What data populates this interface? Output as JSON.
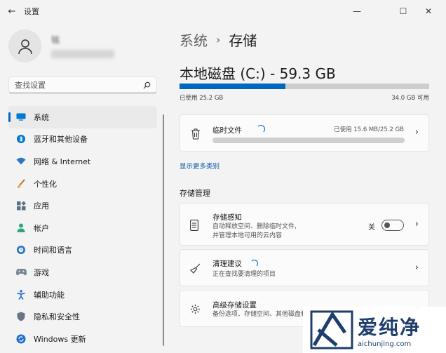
{
  "window": {
    "title": "设置",
    "back_glyph": "←",
    "min_glyph": "—",
    "max_glyph": "☐",
    "close_glyph": "✕"
  },
  "user": {
    "name": "铭"
  },
  "search": {
    "placeholder": "查找设置"
  },
  "nav": [
    {
      "label": "系统",
      "icon": "monitor-icon",
      "selected": true
    },
    {
      "label": "蓝牙和其他设备",
      "icon": "bluetooth-icon"
    },
    {
      "label": "网络 & Internet",
      "icon": "wifi-icon"
    },
    {
      "label": "个性化",
      "icon": "brush-icon"
    },
    {
      "label": "应用",
      "icon": "apps-icon"
    },
    {
      "label": "帐户",
      "icon": "person-icon"
    },
    {
      "label": "时间和语言",
      "icon": "globe-clock-icon"
    },
    {
      "label": "游戏",
      "icon": "gamepad-icon"
    },
    {
      "label": "辅助功能",
      "icon": "accessibility-icon"
    },
    {
      "label": "隐私和安全性",
      "icon": "shield-icon"
    },
    {
      "label": "Windows 更新",
      "icon": "update-icon"
    }
  ],
  "breadcrumb": {
    "parent": "系统",
    "separator": "›",
    "current": "存储"
  },
  "disk": {
    "title": "本地磁盘 (C:) - 59.3 GB",
    "used_label": "已使用 25.2 GB",
    "available_label": "34.0 GB 可用",
    "used_fraction": 0.425
  },
  "temp_files": {
    "title": "临时文件",
    "usage": "已使用 15.6 MB/25.2 GB"
  },
  "show_more": "显示更多类别",
  "storage_mgmt": {
    "heading": "存储管理",
    "sense": {
      "title": "存储感知",
      "desc1": "自动释放空间、删除临时文件,",
      "desc2": "并管理本地可用的云内容",
      "toggle_label": "关",
      "toggle_on": false
    },
    "cleanup": {
      "title": "清理建议",
      "desc": "正在查找要清理的项目"
    },
    "advanced": {
      "title": "高级存储设置",
      "desc": "备份选项、存储空间、其他磁盘和..."
    }
  },
  "watermark": {
    "cn": "爱纯净",
    "en": "aichunjing.com"
  },
  "colors": {
    "accent": "#0067c0",
    "logo": "#1f3e6d"
  }
}
